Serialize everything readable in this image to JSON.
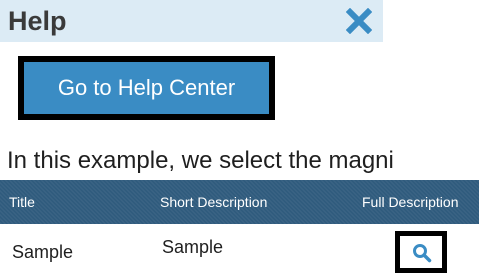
{
  "dialog": {
    "title": "Help",
    "close_icon": "close-icon",
    "help_center_button_label": "Go to Help Center"
  },
  "instruction_text": "In this example, we select the magni",
  "table": {
    "headers": [
      "Title",
      "Short Description",
      "Full Description"
    ],
    "rows": [
      {
        "title": "Sample",
        "short_description": "Sample",
        "full_description_icon": "search-icon"
      }
    ]
  },
  "colors": {
    "header_bg": "#dcebf5",
    "accent_blue": "#3a8cc4",
    "table_header_bg": "#2f5b7d",
    "close_icon": "#3a8cc4"
  }
}
